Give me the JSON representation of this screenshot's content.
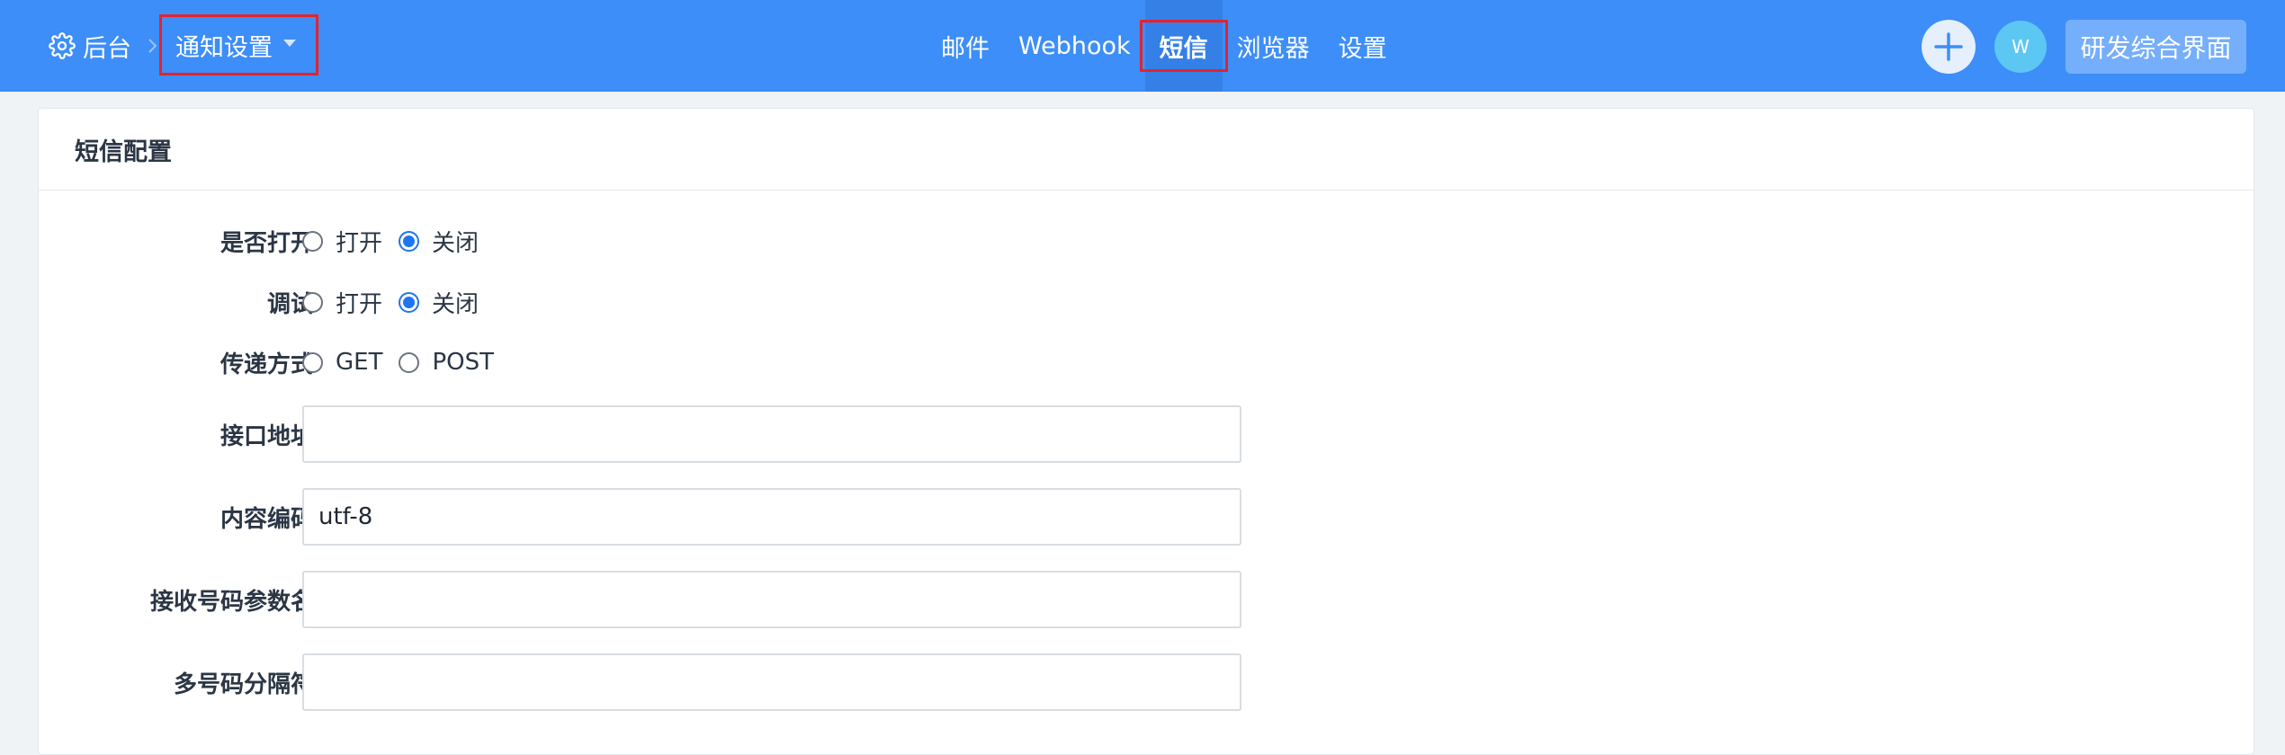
{
  "header": {
    "home_label": "后台",
    "module_select_label": "通知设置",
    "nav": [
      {
        "label": "邮件",
        "active": false
      },
      {
        "label": "Webhook",
        "active": false
      },
      {
        "label": "短信",
        "active": true
      },
      {
        "label": "浏览器",
        "active": false
      },
      {
        "label": "设置",
        "active": false
      }
    ],
    "avatar_initial": "W",
    "workspace_label": "研发综合界面"
  },
  "card": {
    "title": "短信配置"
  },
  "form": {
    "enable": {
      "label": "是否打开",
      "options": [
        "打开",
        "关闭"
      ],
      "selected": "关闭"
    },
    "debug": {
      "label": "调试",
      "options": [
        "打开",
        "关闭"
      ],
      "selected": "关闭"
    },
    "method": {
      "label": "传递方式",
      "options": [
        "GET",
        "POST"
      ],
      "selected": ""
    },
    "api_url": {
      "label": "接口地址",
      "value": ""
    },
    "encoding": {
      "label": "内容编码",
      "value": "utf-8"
    },
    "phone_param": {
      "label": "接收号码参数名",
      "value": ""
    },
    "separator": {
      "label": "多号码分隔符",
      "value": ""
    }
  },
  "colors": {
    "topbar": "#3d8ef8",
    "active_tab": "#3580e6",
    "highlight_border": "#e8212b",
    "radio_checked": "#1f74f2"
  }
}
